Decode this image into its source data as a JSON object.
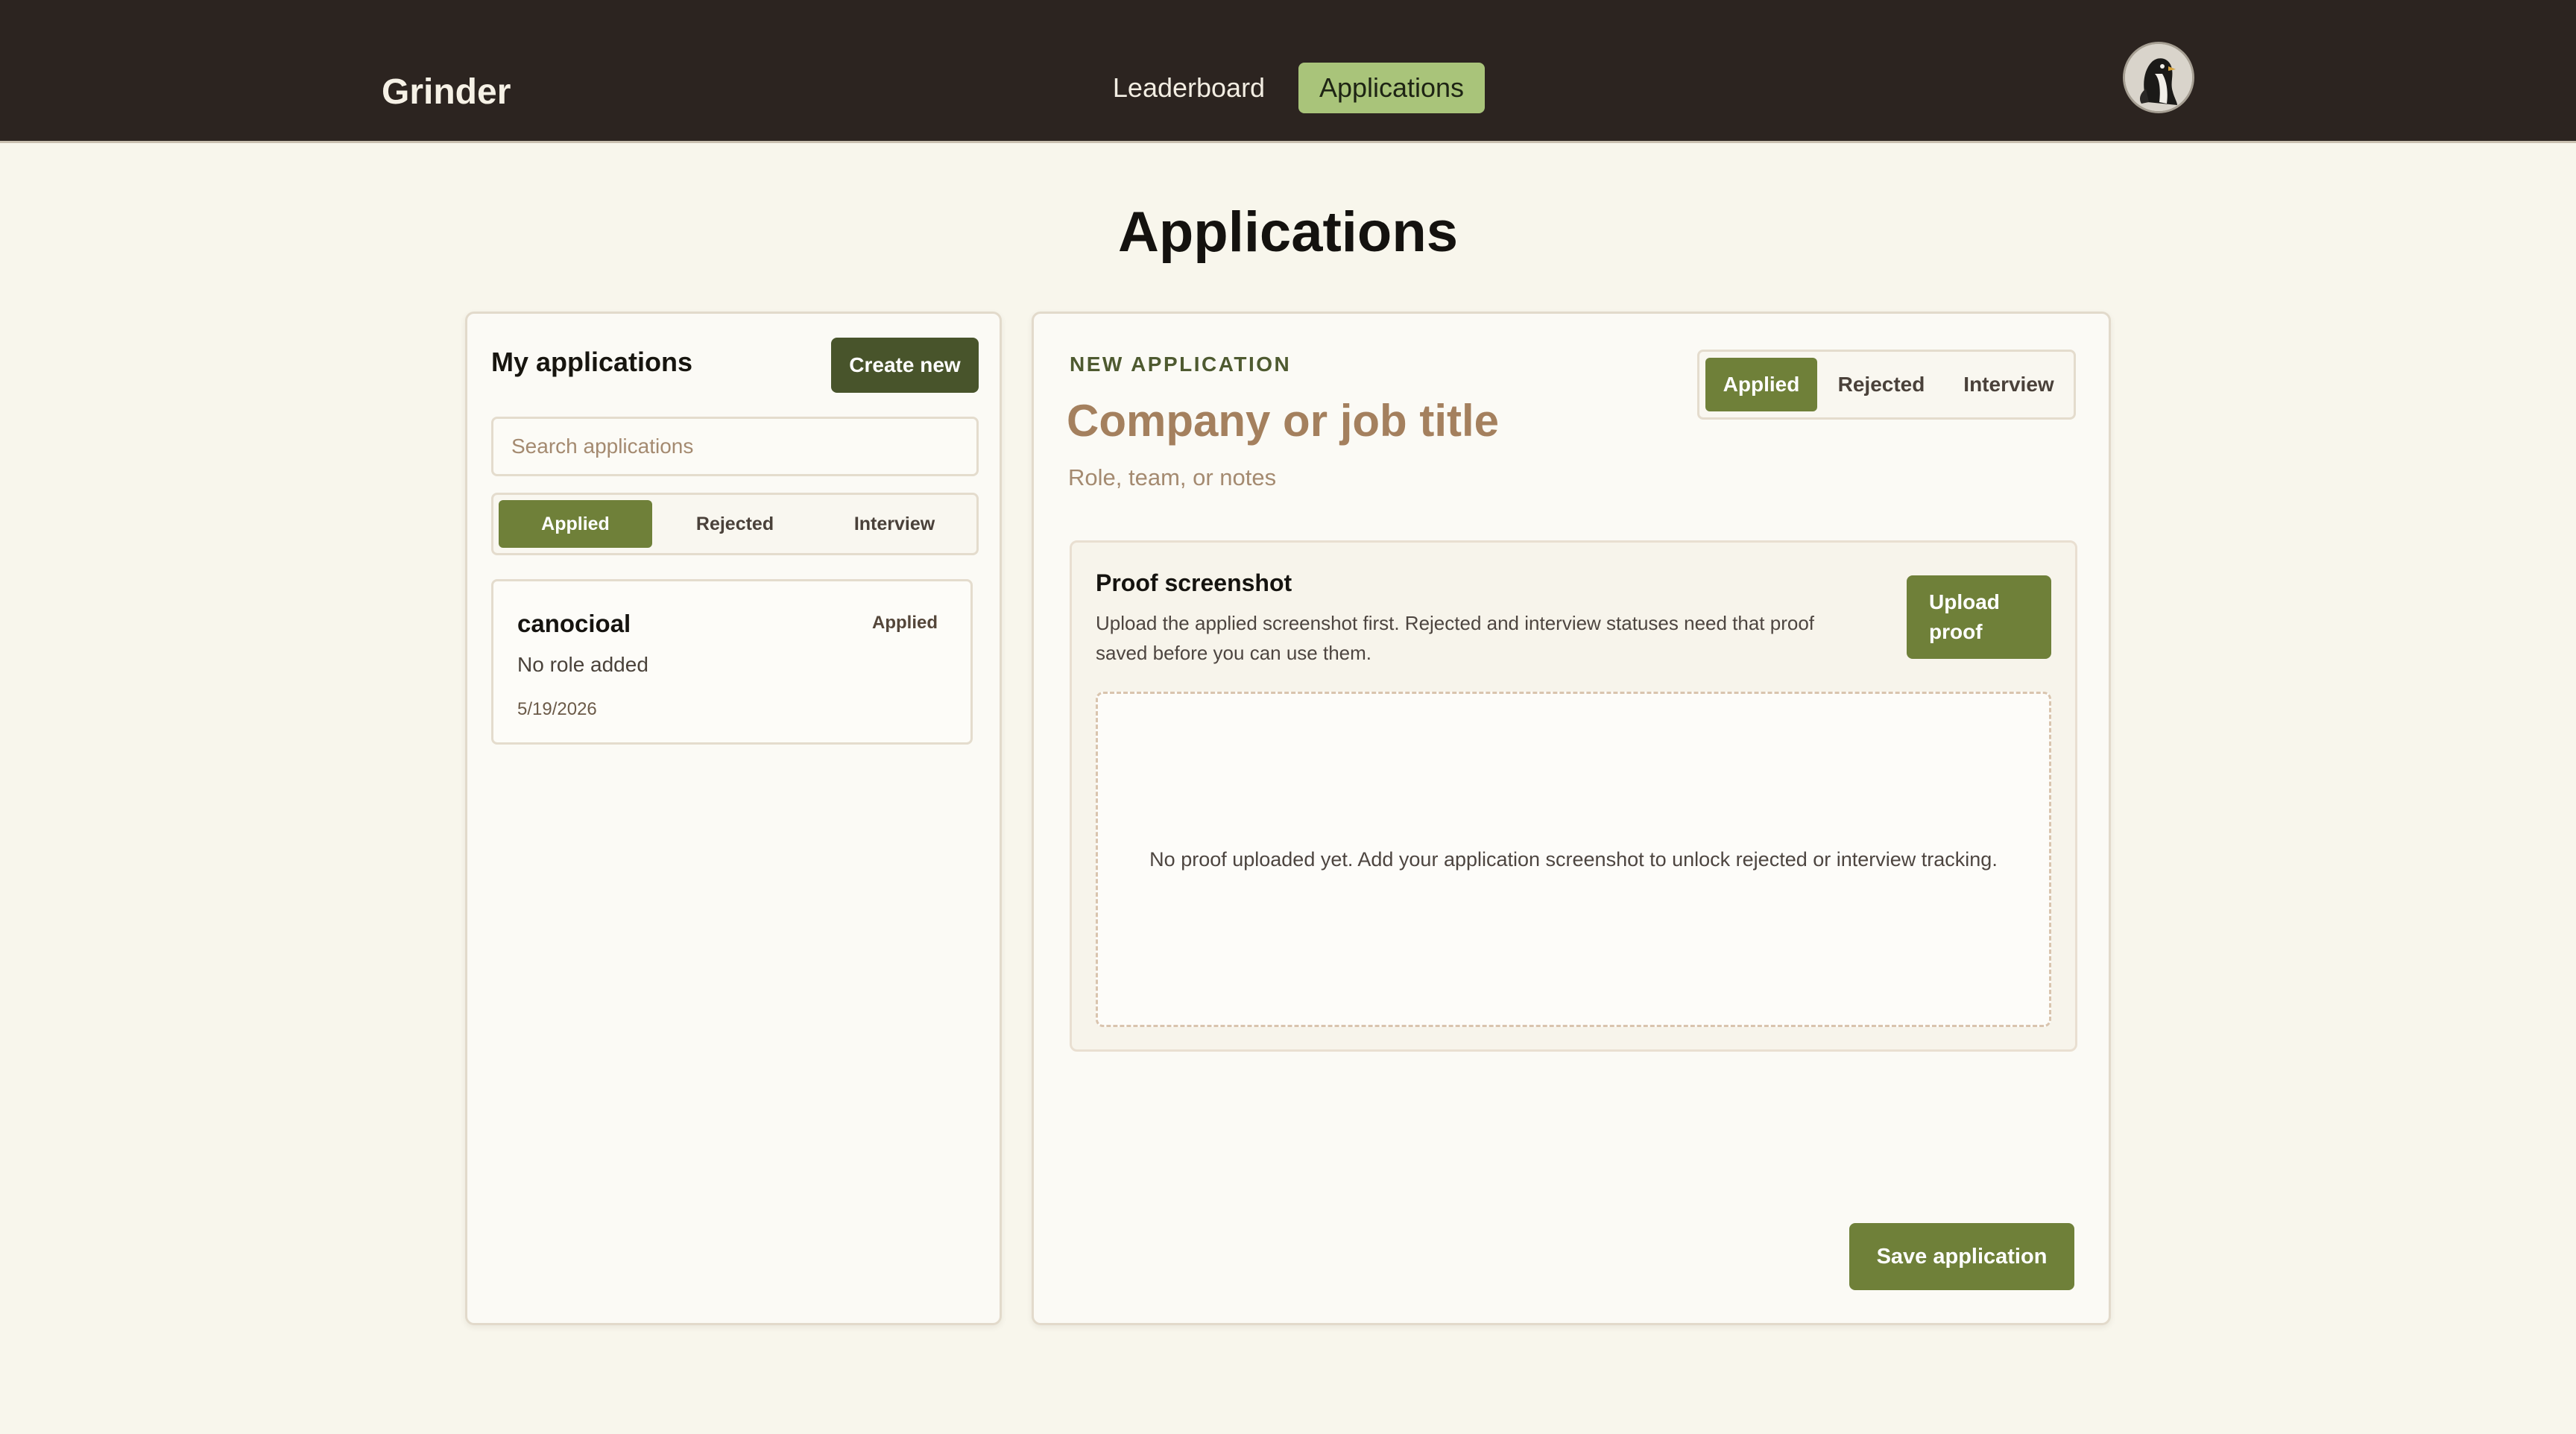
{
  "app": {
    "brand": "Grinder",
    "nav": [
      {
        "label": "Leaderboard",
        "active": false
      },
      {
        "label": "Applications",
        "active": true
      }
    ],
    "avatar_icon": "penguin-avatar-icon"
  },
  "page": {
    "title": "Applications"
  },
  "sidebar": {
    "heading": "My applications",
    "create_label": "Create new",
    "search_placeholder": "Search applications",
    "search_value": "",
    "filters": [
      {
        "label": "Applied",
        "active": true
      },
      {
        "label": "Rejected",
        "active": false
      },
      {
        "label": "Interview",
        "active": false
      }
    ],
    "applications": [
      {
        "title": "canocioal",
        "status": "Applied",
        "role": "No role added",
        "date": "5/19/2026"
      }
    ]
  },
  "editor": {
    "eyebrow": "NEW APPLICATION",
    "title_placeholder": "Company or job title",
    "notes_placeholder": "Role, team, or notes",
    "statuses": [
      {
        "label": "Applied",
        "active": true
      },
      {
        "label": "Rejected",
        "active": false
      },
      {
        "label": "Interview",
        "active": false
      }
    ],
    "proof": {
      "title": "Proof screenshot",
      "description": "Upload the applied screenshot first. Rejected and interview statuses need that proof saved before you can use them.",
      "upload_label": "Upload proof",
      "empty_message": "No proof uploaded yet. Add your application screenshot to unlock rejected or interview tracking."
    },
    "save_label": "Save application"
  },
  "colors": {
    "topbar": "#2c2420",
    "accent": "#6f8039",
    "accent_dark": "#48542b",
    "nav_active": "#a9c47a",
    "background": "#f8f6ec",
    "placeholder_brown": "#a4805e"
  }
}
